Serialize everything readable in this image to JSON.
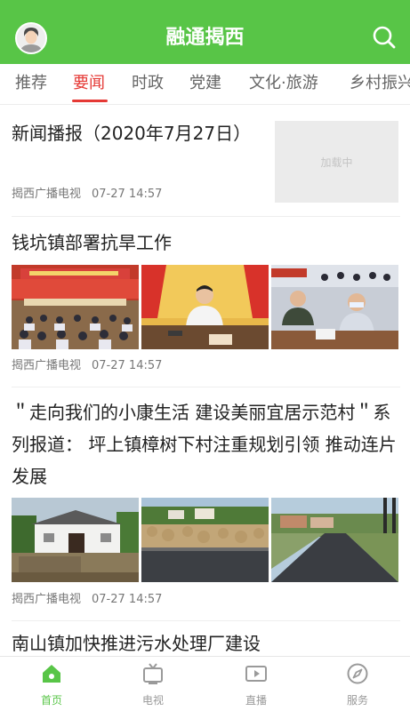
{
  "header": {
    "title": "融通揭西",
    "accent_color": "#58c547"
  },
  "tabs": [
    {
      "label": "推荐"
    },
    {
      "label": "要闻",
      "active": true
    },
    {
      "label": "时政"
    },
    {
      "label": "党建"
    },
    {
      "label": "文化·旅游"
    },
    {
      "label": "乡村振兴"
    }
  ],
  "feed": [
    {
      "title": "新闻播报（2020年7月27日）",
      "thumbnail_status": "加载中",
      "source": "揭西广播电视",
      "time": "07-27 14:57"
    },
    {
      "title": "钱坑镇部署抗旱工作",
      "source": "揭西广播电视",
      "time": "07-27 14:57",
      "images": [
        "meeting-hall-photo",
        "speaker-at-podium-photo",
        "meeting-attendees-photo"
      ]
    },
    {
      "title": "＂走向我们的小康生活  建设美丽宜居示范村＂系列报道： 坪上镇樟树下村注重规划引领  推动连片发展",
      "source": "揭西广播电视",
      "time": "07-27 14:57",
      "images": [
        "village-house-photo",
        "stone-pile-road-photo",
        "paved-village-road-photo"
      ]
    },
    {
      "title": "南山镇加快推进污水处理厂建设"
    }
  ],
  "bottom_nav": [
    {
      "label": "首页",
      "icon": "home-icon",
      "active": true
    },
    {
      "label": "电视",
      "icon": "tv-icon"
    },
    {
      "label": "直播",
      "icon": "live-play-icon"
    },
    {
      "label": "服务",
      "icon": "compass-icon"
    }
  ]
}
